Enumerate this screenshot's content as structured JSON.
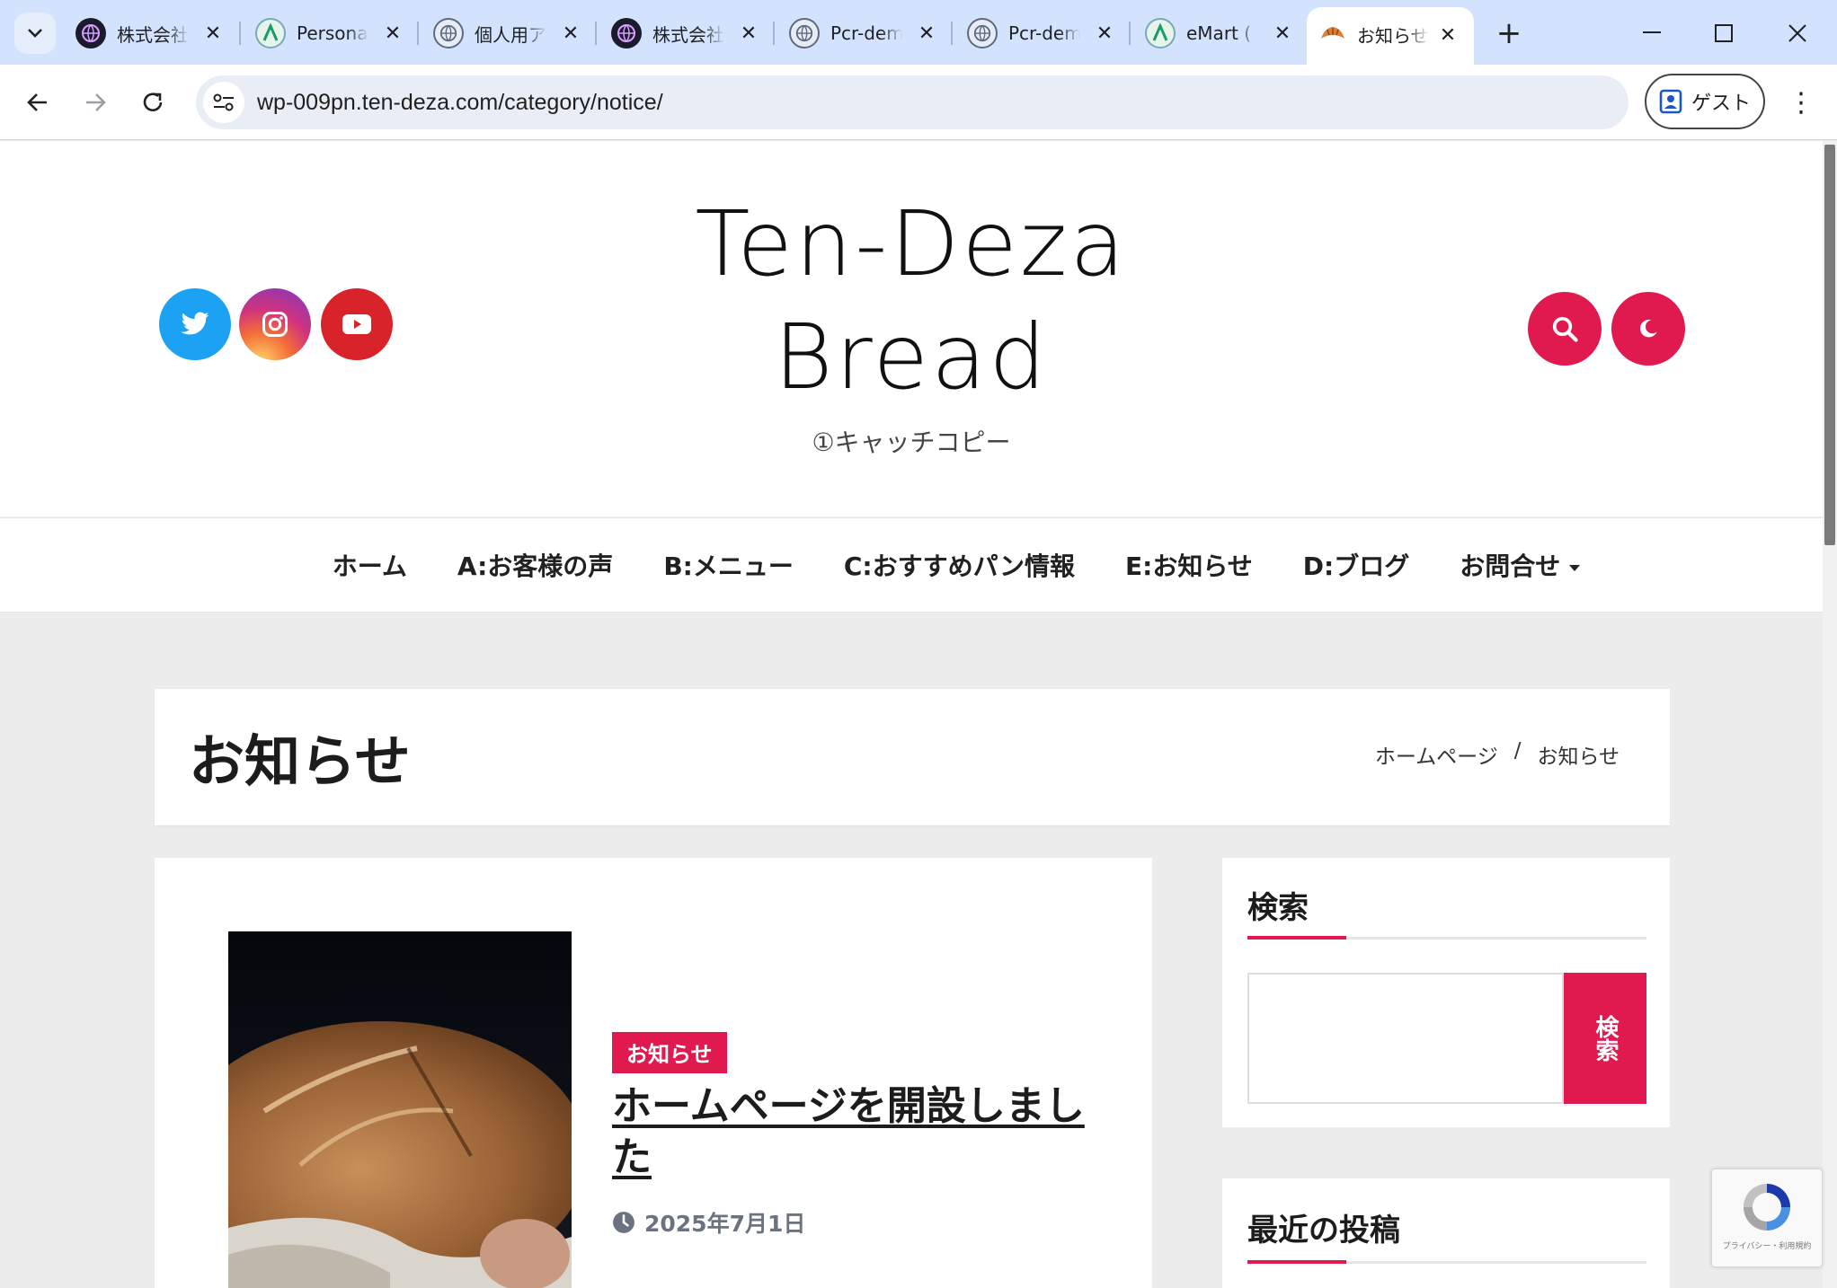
{
  "browser": {
    "tabs": [
      {
        "title": "株式会社",
        "favicon": "blue-globe-icon",
        "active": false
      },
      {
        "title": "Personal",
        "favicon": "green-a-icon",
        "active": false
      },
      {
        "title": "個人用ア",
        "favicon": "globe-icon",
        "active": false
      },
      {
        "title": "株式会社",
        "favicon": "blue-globe-icon",
        "active": false
      },
      {
        "title": "Pcr-demo",
        "favicon": "globe-icon",
        "active": false
      },
      {
        "title": "Pcr-demo",
        "favicon": "globe-icon",
        "active": false
      },
      {
        "title": "eMart (",
        "favicon": "green-a-icon",
        "active": false
      },
      {
        "title": "お知らせ",
        "favicon": "croissant-icon",
        "active": true
      }
    ],
    "url": "wp-009pn.ten-deza.com/category/notice/",
    "guest_label": "ゲスト"
  },
  "site": {
    "title_line1": "Ten-Deza",
    "title_line2": "Bread",
    "tagline": "①キャッチコピー",
    "social": [
      "twitter-icon",
      "instagram-icon",
      "youtube-icon"
    ]
  },
  "nav": {
    "items": [
      "ホーム",
      "A:お客様の声",
      "B:メニュー",
      "C:おすすめパン情報",
      "E:お知らせ",
      "D:ブログ",
      "お問合せ"
    ]
  },
  "page": {
    "heading": "お知らせ",
    "breadcrumb": [
      "ホームページ",
      "/",
      "お知らせ"
    ]
  },
  "post": {
    "category": "お知らせ",
    "title": "ホームページを開設しました",
    "date": "2025年7月1日"
  },
  "sidebar": {
    "search_title": "検索",
    "search_button": "検索",
    "recent_title": "最近の投稿"
  },
  "recaptcha": {
    "text": "プライバシー・利用規約"
  },
  "colors": {
    "accent": "#e01a4f",
    "tabbar": "#d3e3fd",
    "twitter": "#1da1f2",
    "youtube": "#d9232b"
  }
}
